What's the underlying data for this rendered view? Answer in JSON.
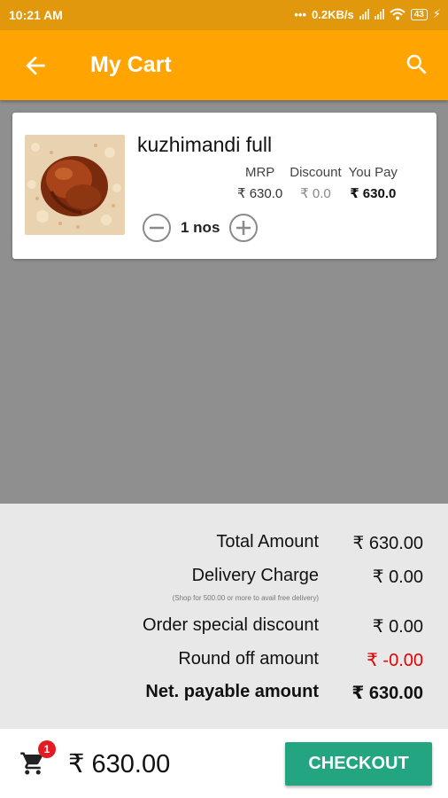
{
  "status_bar": {
    "time": "10:21 AM",
    "network_speed": "0.2KB/s",
    "battery": "43"
  },
  "app_bar": {
    "title": "My Cart",
    "back_icon": "arrow-left-icon",
    "search_icon": "search-icon"
  },
  "cart_items": [
    {
      "name": "kuzhimandi full",
      "image": "chicken-mandi-photo",
      "price_headers": [
        "MRP",
        "Discount",
        "You Pay"
      ],
      "mrp": "₹ 630.0",
      "discount": "₹ 0.0",
      "you_pay": "₹ 630.0",
      "quantity": "1 nos"
    }
  ],
  "summary": {
    "total_amount_label": "Total Amount",
    "total_amount_value": "₹ 630.00",
    "delivery_charge_label": "Delivery Charge",
    "delivery_charge_value": "₹ 0.00",
    "delivery_note": "(Shop for 500.00 or more to avail free delivery)",
    "special_discount_label": "Order special discount",
    "special_discount_value": "₹ 0.00",
    "round_off_label": "Round off amount",
    "round_off_value": "₹ -0.00",
    "net_payable_label": "Net. payable amount",
    "net_payable_value": "₹ 630.00"
  },
  "bottom_bar": {
    "cart_count": "1",
    "total": "₹ 630.00",
    "checkout_label": "CHECKOUT"
  },
  "colors": {
    "status_bar": "#e2980c",
    "app_bar": "#ffa400",
    "checkout": "#22a580",
    "badge": "#e31b23",
    "negative": "#e60000"
  }
}
